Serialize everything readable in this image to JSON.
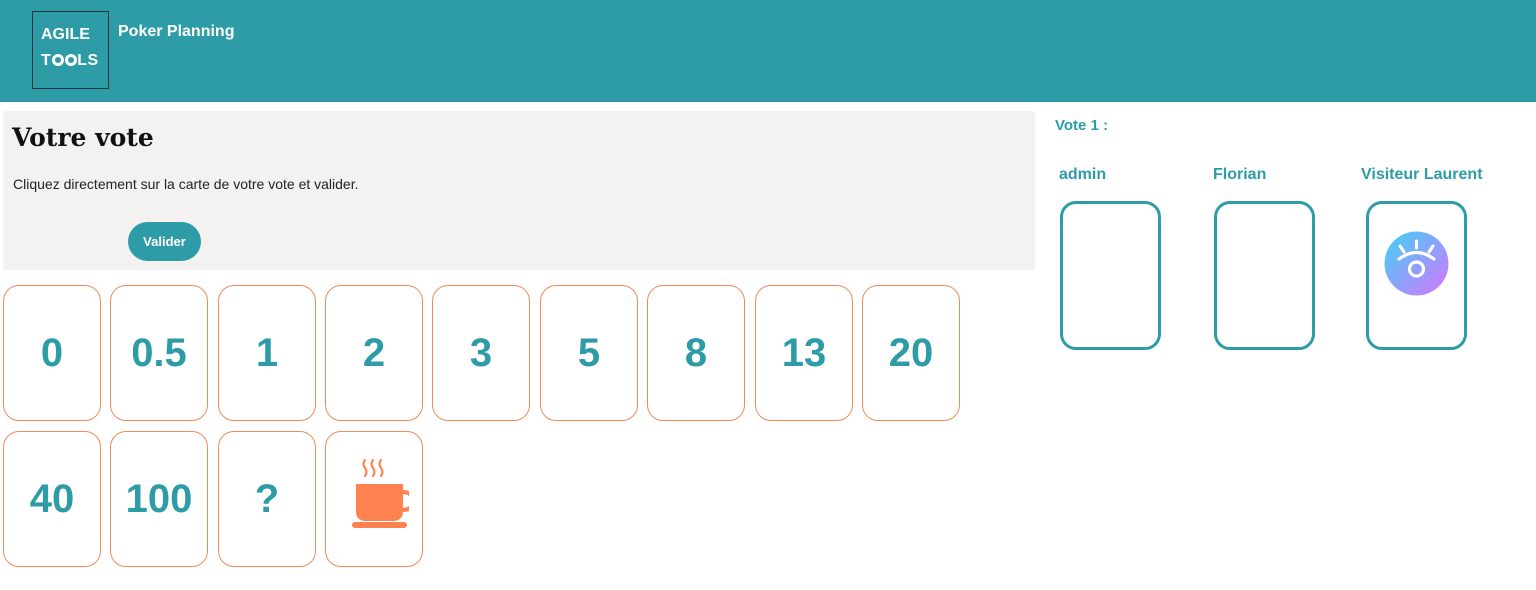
{
  "header": {
    "logo_line1": "AGILE",
    "logo_line2_prefix": "T",
    "logo_line2_suffix": "LS",
    "app_title": "Poker Planning"
  },
  "vote_panel": {
    "title": "Votre vote",
    "instructions": "Cliquez directement sur la carte de votre vote et valider.",
    "submit_label": "Valider"
  },
  "cards": [
    "0",
    "0.5",
    "1",
    "2",
    "3",
    "5",
    "8",
    "13",
    "20",
    "40",
    "100",
    "?"
  ],
  "coffee_card_icon": "coffee-cup-icon",
  "round": {
    "label": "Vote 1 :"
  },
  "players": [
    {
      "name": "admin",
      "card_state": "empty"
    },
    {
      "name": "Florian",
      "card_state": "empty"
    },
    {
      "name": "Visiteur Laurent",
      "card_state": "observer",
      "icon": "eye-icon"
    }
  ],
  "colors": {
    "accent": "#2e9ca6",
    "card_border": "#f28a5c",
    "coffee": "#ff8250",
    "panel_bg": "#f3f2f0"
  }
}
